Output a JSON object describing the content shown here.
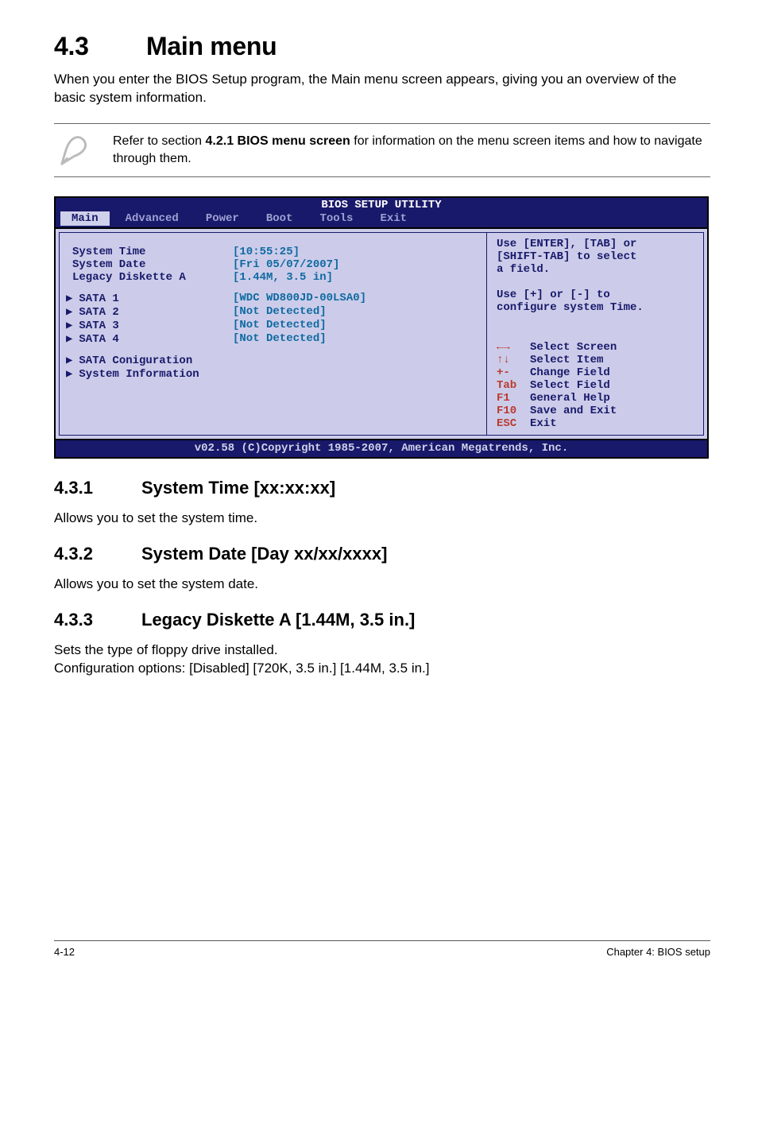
{
  "heading": {
    "num": "4.3",
    "text": "Main menu"
  },
  "intro": "When you enter the BIOS Setup program, the Main menu screen appears, giving you an overview of the basic system information.",
  "note": {
    "prefix": "Refer to section ",
    "bold": "4.2.1  BIOS menu screen",
    "suffix": " for information on the menu screen items and how to navigate through them."
  },
  "bios": {
    "title": "BIOS SETUP UTILITY",
    "menus": [
      "Main",
      "Advanced",
      "Power",
      "Boot",
      "Tools",
      "Exit"
    ],
    "selected_menu_index": 0,
    "rows": [
      {
        "label": "System Time",
        "value": "[10:55:25]",
        "arrow": false
      },
      {
        "label": "System Date",
        "value": "[Fri 05/07/2007]",
        "arrow": false
      },
      {
        "label": "Legacy Diskette A",
        "value": "[1.44M, 3.5 in]",
        "arrow": false
      }
    ],
    "sata_rows": [
      {
        "label": "SATA 1",
        "value": "[WDC WD800JD-00LSA0]"
      },
      {
        "label": "SATA 2",
        "value": "[Not Detected]"
      },
      {
        "label": "SATA 3",
        "value": "[Not Detected]"
      },
      {
        "label": "SATA 4",
        "value": "[Not Detected]"
      }
    ],
    "sub_items": [
      "SATA Coniguration",
      "System Information"
    ],
    "help_top": [
      "Use [ENTER], [TAB] or",
      "[SHIFT-TAB] to select",
      "a field.",
      "",
      "Use [+] or [-] to",
      "configure system Time."
    ],
    "legend": [
      {
        "sym": "←→",
        "text": "Select Screen"
      },
      {
        "sym": "↑↓",
        "text": "Select Item"
      },
      {
        "sym": "+-",
        "text": "Change Field"
      },
      {
        "sym": "Tab",
        "text": "Select Field"
      },
      {
        "sym": "F1",
        "text": "General Help"
      },
      {
        "sym": "F10",
        "text": "Save and Exit"
      },
      {
        "sym": "ESC",
        "text": "Exit"
      }
    ],
    "footer": "v02.58 (C)Copyright 1985-2007, American Megatrends, Inc."
  },
  "sections": [
    {
      "num": "4.3.1",
      "title": "System Time [xx:xx:xx]",
      "body": "Allows you to set the system time."
    },
    {
      "num": "4.3.2",
      "title": "System Date [Day xx/xx/xxxx]",
      "body": "Allows you to set the system date."
    },
    {
      "num": "4.3.3",
      "title": "Legacy Diskette A [1.44M, 3.5 in.]",
      "body_lines": [
        "Sets the type of floppy drive installed.",
        "Configuration options: [Disabled] [720K, 3.5 in.] [1.44M, 3.5 in.]"
      ]
    }
  ],
  "footer": {
    "left": "4-12",
    "right": "Chapter 4: BIOS setup"
  }
}
